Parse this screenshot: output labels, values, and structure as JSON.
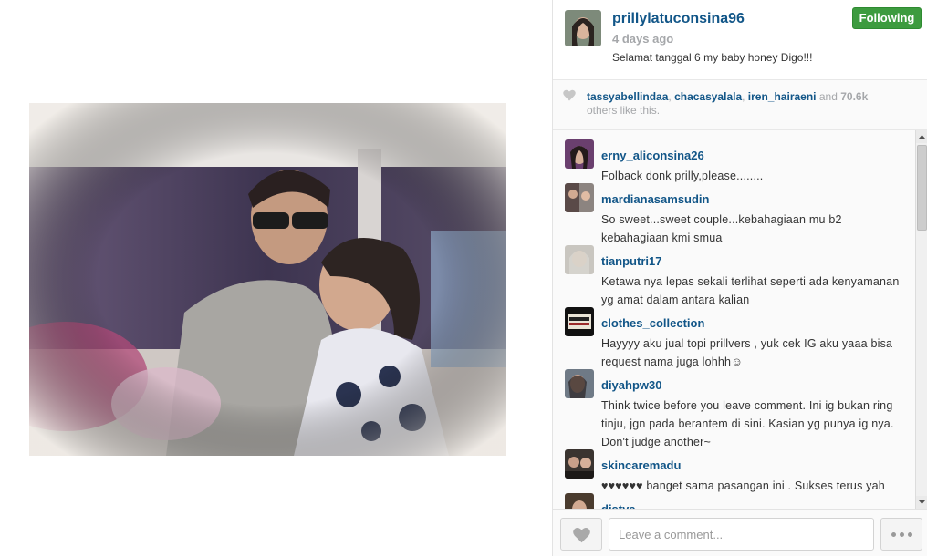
{
  "post": {
    "username": "prillylatuconsina96",
    "time_ago": "4 days ago",
    "caption": "Selamat tanggal 6 my baby honey Digo!!!",
    "follow_label": "Following"
  },
  "likes": {
    "users": [
      "tassyabellindaa",
      "chacasyalala",
      "iren_hairaeni"
    ],
    "and_text": "and",
    "count": "70.6k",
    "suffix": "others like this."
  },
  "comments": [
    {
      "user": "erny_aliconsina26",
      "text": "Folback donk prilly,please........"
    },
    {
      "user": "mardianasamsudin",
      "text": "So sweet...sweet couple...kebahagiaan mu b2 kebahagiaan kmi smua"
    },
    {
      "user": "tianputri17",
      "text": "Ketawa nya lepas sekali terlihat seperti ada kenyamanan yg amat dalam antara kalian"
    },
    {
      "user": "clothes_collection",
      "text": "Hayyyy aku jual topi prillvers , yuk cek IG aku yaaa bisa request nama juga lohhh☺"
    },
    {
      "user": "diyahpw30",
      "text": "Think twice before you leave comment. Ini ig bukan ring tinju, jgn pada berantem di sini. Kasian yg punya ig nya. Don't judge another~"
    },
    {
      "user": "skincaremadu",
      "text": "♥♥♥♥♥♥ banget sama pasangan ini . Sukses terus yah"
    },
    {
      "user": "distya",
      "text": ""
    }
  ],
  "footer": {
    "comment_placeholder": "Leave a comment..."
  },
  "colors": {
    "username": "#125688",
    "follow_button": "#3d9b3f",
    "muted": "#a5a7aa"
  },
  "icons": {
    "like": "heart-icon",
    "more": "more-dots-icon",
    "scroll_up": "arrow-up-icon",
    "scroll_down": "arrow-down-icon"
  }
}
